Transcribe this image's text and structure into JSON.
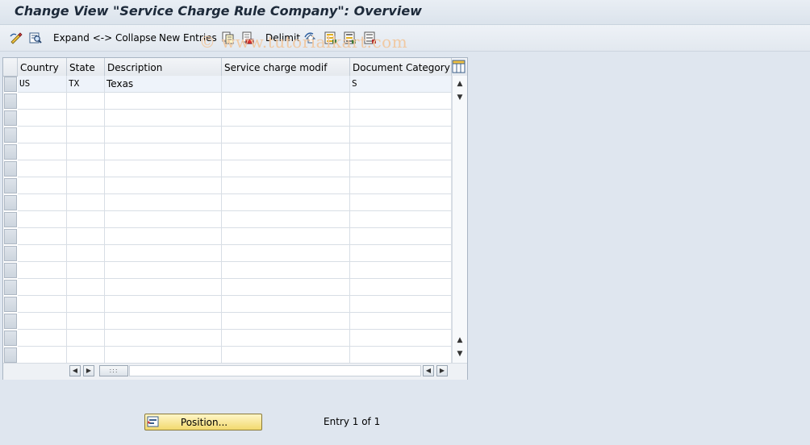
{
  "window": {
    "title": "Change View \"Service Charge Rule Company\": Overview"
  },
  "toolbar": {
    "expand_collapse_label": "Expand <-> Collapse",
    "new_entries_label": "New Entries",
    "delimit_label": "Delimit",
    "icons": [
      "change-display-icon",
      "details-icon",
      "copy-as-icon",
      "delete-icon",
      "undo-icon",
      "select-all-icon",
      "select-block-icon",
      "deselect-all-icon"
    ]
  },
  "watermark": "© www.tutorialkart.com",
  "table": {
    "columns": [
      "Country",
      "State",
      "Description",
      "Service charge modif",
      "Document Category"
    ],
    "rows": [
      [
        "US",
        "TX",
        "Texas",
        "",
        "S"
      ],
      [
        "",
        "",
        "",
        "",
        ""
      ],
      [
        "",
        "",
        "",
        "",
        ""
      ],
      [
        "",
        "",
        "",
        "",
        ""
      ],
      [
        "",
        "",
        "",
        "",
        ""
      ],
      [
        "",
        "",
        "",
        "",
        ""
      ],
      [
        "",
        "",
        "",
        "",
        ""
      ],
      [
        "",
        "",
        "",
        "",
        ""
      ],
      [
        "",
        "",
        "",
        "",
        ""
      ],
      [
        "",
        "",
        "",
        "",
        ""
      ],
      [
        "",
        "",
        "",
        "",
        ""
      ],
      [
        "",
        "",
        "",
        "",
        ""
      ],
      [
        "",
        "",
        "",
        "",
        ""
      ],
      [
        "",
        "",
        "",
        "",
        ""
      ],
      [
        "",
        "",
        "",
        "",
        ""
      ],
      [
        "",
        "",
        "",
        "",
        ""
      ],
      [
        "",
        "",
        "",
        "",
        ""
      ]
    ]
  },
  "footer": {
    "position_button_label": "Position...",
    "entry_status": "Entry 1 of 1"
  },
  "colors": {
    "background": "#dfe6ef",
    "position_button": "#f2d96e"
  }
}
